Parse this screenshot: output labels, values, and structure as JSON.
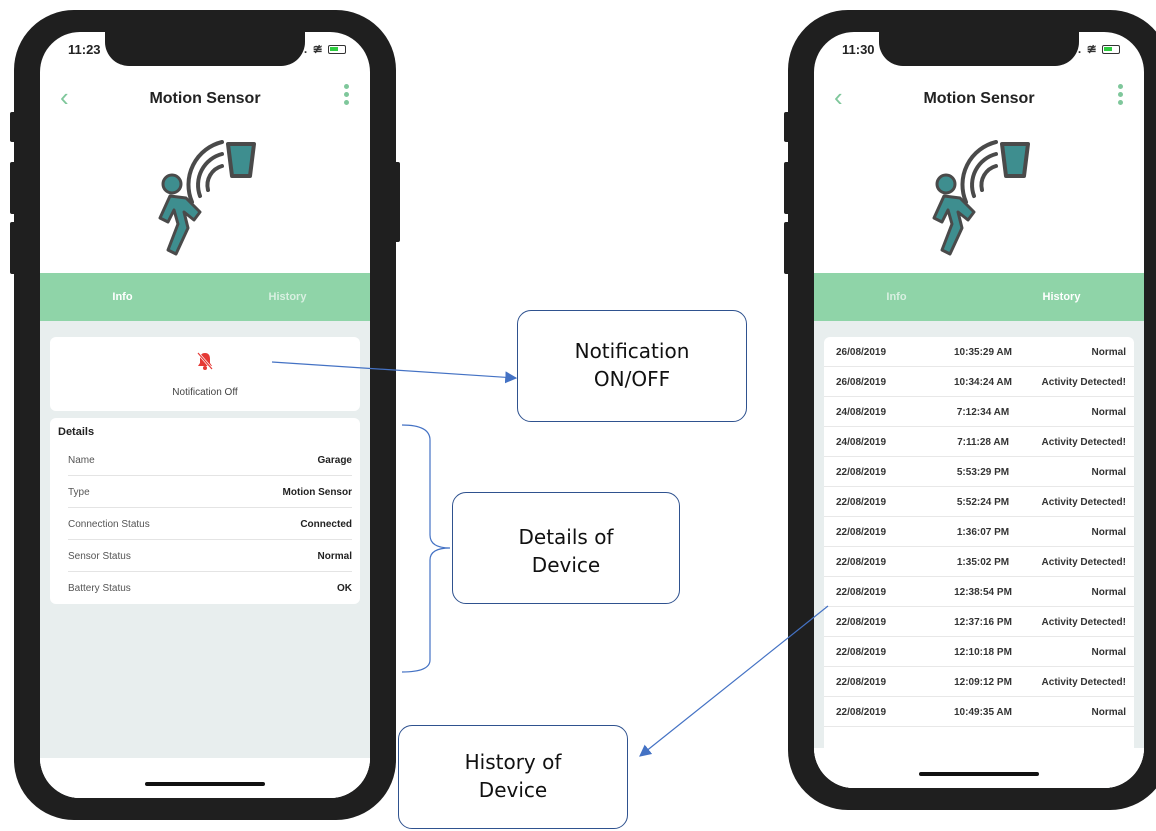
{
  "phones": {
    "left": {
      "time": "11:23",
      "title": "Motion Sensor",
      "tabs": [
        {
          "label": "Info",
          "active": true
        },
        {
          "label": "History",
          "active": false
        }
      ],
      "notification_label": "Notification Off",
      "details_title": "Details",
      "details": [
        {
          "label": "Name",
          "value": "Garage"
        },
        {
          "label": "Type",
          "value": "Motion Sensor"
        },
        {
          "label": "Connection Status",
          "value": "Connected"
        },
        {
          "label": "Sensor Status",
          "value": "Normal"
        },
        {
          "label": "Battery Status",
          "value": "OK"
        }
      ]
    },
    "right": {
      "time": "11:30",
      "title": "Motion Sensor",
      "tabs": [
        {
          "label": "Info",
          "active": false
        },
        {
          "label": "History",
          "active": true
        }
      ],
      "history": [
        {
          "date": "26/08/2019",
          "time": "10:35:29 AM",
          "status": "Normal"
        },
        {
          "date": "26/08/2019",
          "time": "10:34:24 AM",
          "status": "Activity Detected!"
        },
        {
          "date": "24/08/2019",
          "time": "7:12:34 AM",
          "status": "Normal"
        },
        {
          "date": "24/08/2019",
          "time": "7:11:28 AM",
          "status": "Activity Detected!"
        },
        {
          "date": "22/08/2019",
          "time": "5:53:29 PM",
          "status": "Normal"
        },
        {
          "date": "22/08/2019",
          "time": "5:52:24 PM",
          "status": "Activity Detected!"
        },
        {
          "date": "22/08/2019",
          "time": "1:36:07 PM",
          "status": "Normal"
        },
        {
          "date": "22/08/2019",
          "time": "1:35:02 PM",
          "status": "Activity Detected!"
        },
        {
          "date": "22/08/2019",
          "time": "12:38:54 PM",
          "status": "Normal"
        },
        {
          "date": "22/08/2019",
          "time": "12:37:16 PM",
          "status": "Activity Detected!"
        },
        {
          "date": "22/08/2019",
          "time": "12:10:18 PM",
          "status": "Normal"
        },
        {
          "date": "22/08/2019",
          "time": "12:09:12 PM",
          "status": "Activity Detected!"
        },
        {
          "date": "22/08/2019",
          "time": "10:49:35 AM",
          "status": "Normal"
        }
      ]
    }
  },
  "callouts": {
    "notification": {
      "line1": "Notification",
      "line2": "ON/OFF"
    },
    "details": {
      "line1": "Details of",
      "line2": "Device"
    },
    "history": {
      "line1": "History of",
      "line2": "Device"
    }
  },
  "colors": {
    "accent": "#8fd4a8",
    "icon_teal": "#3e8e8f",
    "icon_dark": "#4a4a4a",
    "bell_red": "#e53935",
    "callout_border": "#2f528f",
    "arrow": "#4472c4"
  },
  "icons": {
    "back": "chevron-left-icon",
    "menu": "more-vertical-icon",
    "bell": "bell-off-icon",
    "hero": "motion-sensor-icon"
  }
}
